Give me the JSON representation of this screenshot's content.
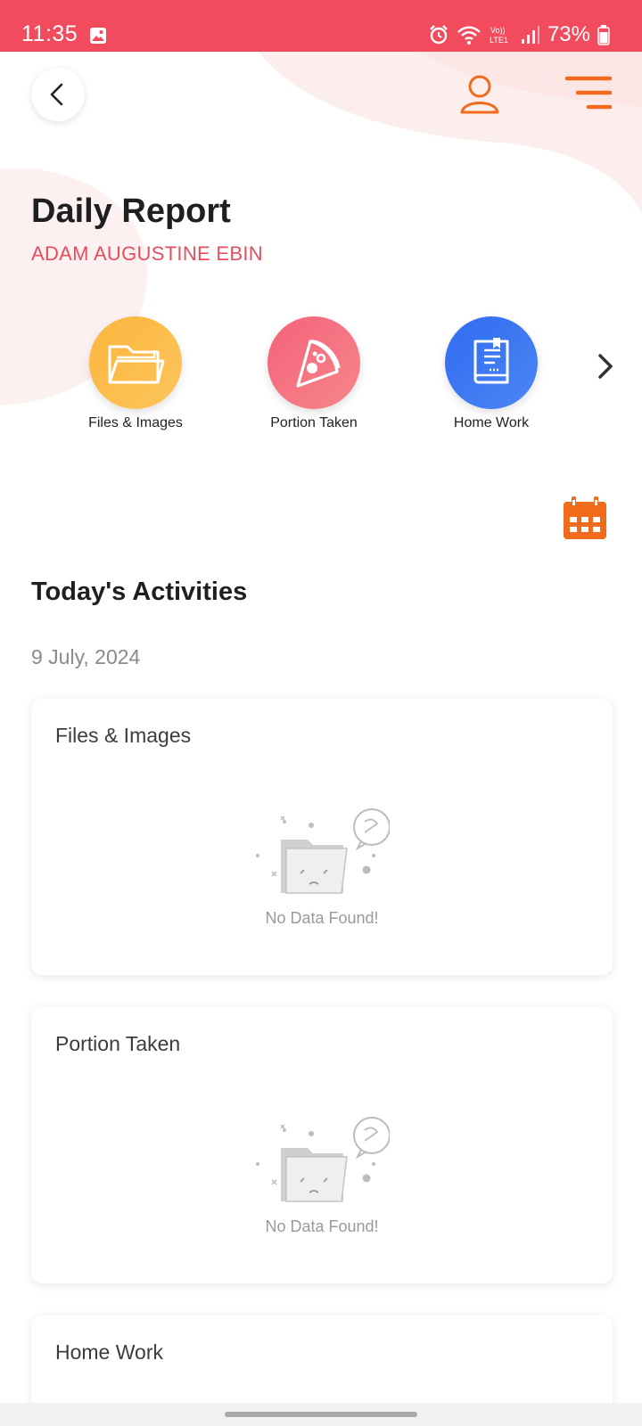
{
  "status_bar": {
    "time": "11:35",
    "battery": "73%",
    "icons": [
      "gallery-icon",
      "alarm-icon",
      "wifi-icon",
      "volte-icon",
      "signal-icon",
      "battery-icon"
    ]
  },
  "header": {
    "back_icon": "chevron-left-icon",
    "profile_icon": "user-icon",
    "menu_icon": "menu-icon"
  },
  "page": {
    "title": "Daily Report",
    "student_name": "ADAM AUGUSTINE EBIN"
  },
  "categories": [
    {
      "label": "Files & Images",
      "icon": "folder-icon",
      "color": "#fbb53d"
    },
    {
      "label": "Portion Taken",
      "icon": "pizza-slice-icon",
      "color": "#f4637a"
    },
    {
      "label": "Home Work",
      "icon": "book-icon",
      "color": "#2f6cf0"
    }
  ],
  "activities": {
    "title": "Today's Activities",
    "date": "9 July, 2024",
    "cards": [
      {
        "title": "Files & Images",
        "empty_text": "No Data Found!"
      },
      {
        "title": "Portion Taken",
        "empty_text": "No Data Found!"
      },
      {
        "title": "Home Work"
      }
    ]
  },
  "colors": {
    "status_bar": "#f24b5e",
    "accent_orange": "#f26a1b",
    "name_red": "#e34f5f"
  }
}
